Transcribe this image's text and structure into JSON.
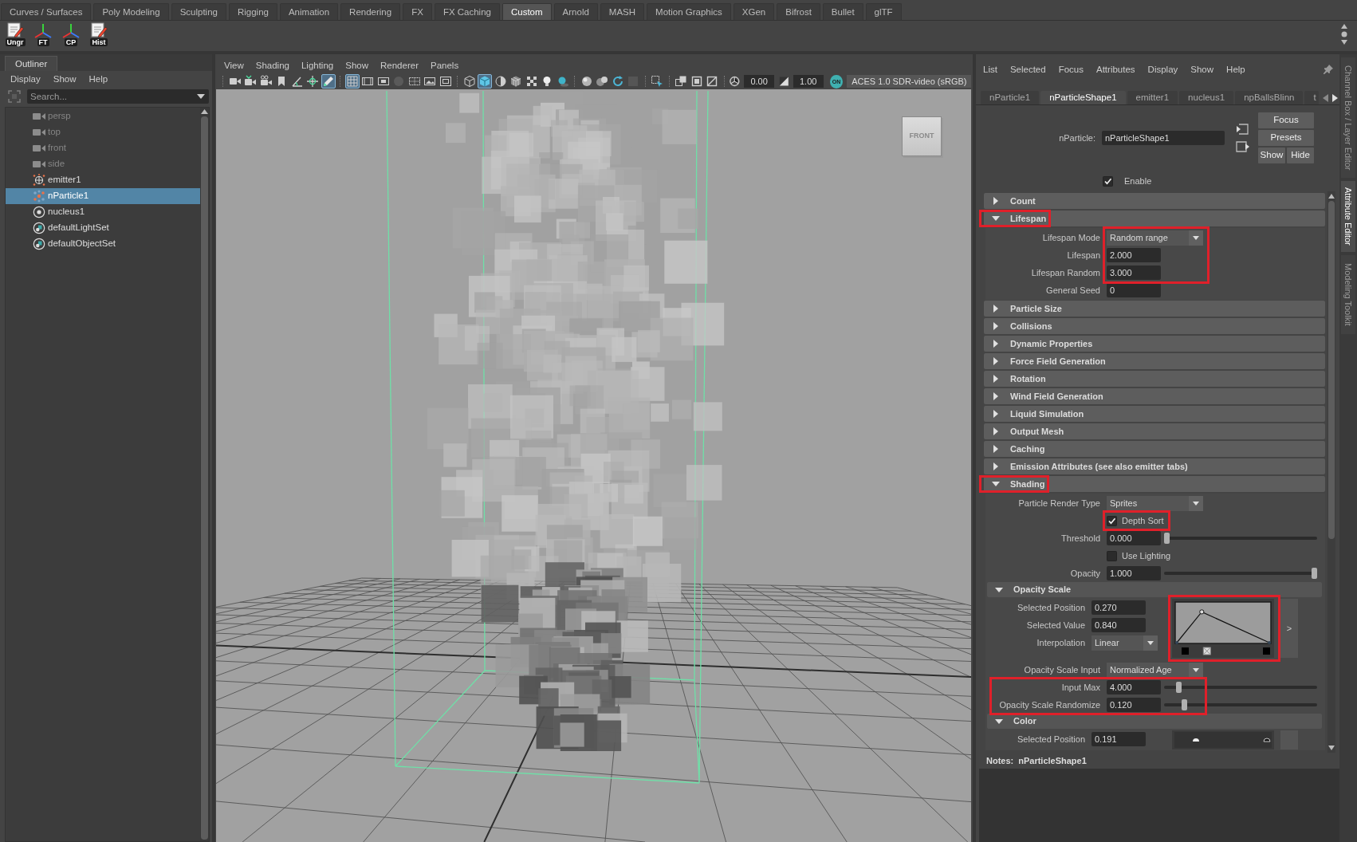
{
  "shelf": {
    "tabs": [
      {
        "label": "Curves / Surfaces",
        "selected": false
      },
      {
        "label": "Poly Modeling",
        "selected": false
      },
      {
        "label": "Sculpting",
        "selected": false
      },
      {
        "label": "Rigging",
        "selected": false
      },
      {
        "label": "Animation",
        "selected": false
      },
      {
        "label": "Rendering",
        "selected": false
      },
      {
        "label": "FX",
        "selected": false
      },
      {
        "label": "FX Caching",
        "selected": false
      },
      {
        "label": "Custom",
        "selected": true
      },
      {
        "label": "Arnold",
        "selected": false
      },
      {
        "label": "MASH",
        "selected": false
      },
      {
        "label": "Motion Graphics",
        "selected": false
      },
      {
        "label": "XGen",
        "selected": false
      },
      {
        "label": "Bifrost",
        "selected": false
      },
      {
        "label": "Bullet",
        "selected": false
      },
      {
        "label": "glTF",
        "selected": false
      }
    ],
    "buttons": [
      {
        "label": "Ungr"
      },
      {
        "label": "FT"
      },
      {
        "label": "CP"
      },
      {
        "label": "Hist"
      }
    ]
  },
  "outliner": {
    "title": "Outliner",
    "menu": [
      "Display",
      "Show",
      "Help"
    ],
    "search": {
      "placeholder": "Search..."
    },
    "items": [
      {
        "label": "persp",
        "kind": "camera",
        "dimmed": true,
        "selected": false
      },
      {
        "label": "top",
        "kind": "camera",
        "dimmed": true,
        "selected": false
      },
      {
        "label": "front",
        "kind": "camera",
        "dimmed": true,
        "selected": false
      },
      {
        "label": "side",
        "kind": "camera",
        "dimmed": true,
        "selected": false
      },
      {
        "label": "emitter1",
        "kind": "emitter",
        "dimmed": false,
        "selected": false
      },
      {
        "label": "nParticle1",
        "kind": "particles",
        "dimmed": false,
        "selected": true
      },
      {
        "label": "nucleus1",
        "kind": "nucleus",
        "dimmed": false,
        "selected": false
      },
      {
        "label": "defaultLightSet",
        "kind": "set",
        "dimmed": false,
        "selected": false
      },
      {
        "label": "defaultObjectSet",
        "kind": "set",
        "dimmed": false,
        "selected": false
      }
    ]
  },
  "viewport": {
    "menu": [
      "View",
      "Shading",
      "Lighting",
      "Show",
      "Renderer",
      "Panels"
    ],
    "toolbar": {
      "buttons": [
        {
          "on": false
        },
        {
          "on": false
        },
        {
          "on": false
        },
        {
          "on": false
        },
        {
          "on": false
        },
        {
          "on": false
        },
        {
          "on": true
        },
        {
          "on": true
        },
        {
          "on": false
        },
        {
          "on": false
        },
        {
          "on": false
        },
        {
          "on": false
        },
        {
          "on": false
        },
        {
          "on": false
        },
        {
          "on": false
        },
        {
          "on": true
        },
        {
          "on": false
        },
        {
          "on": false
        },
        {
          "on": false
        },
        {
          "on": false
        },
        {
          "on": false
        },
        {
          "on": false
        },
        {
          "on": false
        },
        {
          "on": false
        },
        {
          "on": false
        },
        {
          "on": false
        },
        {
          "on": false
        },
        {
          "on": false
        },
        {
          "on": false
        }
      ],
      "exposure": "0.00",
      "gamma": "1.00",
      "color_management": {
        "label": "ON",
        "on": true
      },
      "color_space": "ACES 1.0 SDR-video (sRGB)"
    },
    "view_cube": "FRONT"
  },
  "attribute_editor": {
    "menu": [
      "List",
      "Selected",
      "Focus",
      "Attributes",
      "Display",
      "Show",
      "Help"
    ],
    "tabs": [
      {
        "label": "nParticle1",
        "selected": false
      },
      {
        "label": "nParticleShape1",
        "selected": true
      },
      {
        "label": "emitter1",
        "selected": false
      },
      {
        "label": "nucleus1",
        "selected": false
      },
      {
        "label": "npBallsBlinn",
        "selected": false
      },
      {
        "label": "t",
        "selected": false
      }
    ],
    "node": {
      "label": "nParticle:",
      "value": "nParticleShape1"
    },
    "buttons": [
      "Focus",
      "Presets",
      "Show",
      "Hide"
    ],
    "enable": {
      "label": "Enable",
      "checked": true
    },
    "sections": [
      {
        "title": "Count",
        "expanded": false,
        "highlighted": false
      },
      {
        "title": "Lifespan",
        "expanded": true,
        "highlighted": true,
        "rows": [
          {
            "kind": "dropdown",
            "label": "Lifespan Mode",
            "value": "Random range",
            "highlighted": true
          },
          {
            "kind": "number",
            "label": "Lifespan",
            "value": "2.000",
            "highlighted": true
          },
          {
            "kind": "number",
            "label": "Lifespan Random",
            "value": "3.000",
            "highlighted": true
          },
          {
            "kind": "number",
            "label": "General Seed",
            "value": "0",
            "highlighted": false
          }
        ]
      },
      {
        "title": "Particle Size",
        "expanded": false,
        "highlighted": false
      },
      {
        "title": "Collisions",
        "expanded": false,
        "highlighted": false
      },
      {
        "title": "Dynamic Properties",
        "expanded": false,
        "highlighted": false
      },
      {
        "title": "Force Field Generation",
        "expanded": false,
        "highlighted": false
      },
      {
        "title": "Rotation",
        "expanded": false,
        "highlighted": false
      },
      {
        "title": "Wind Field Generation",
        "expanded": false,
        "highlighted": false
      },
      {
        "title": "Liquid Simulation",
        "expanded": false,
        "highlighted": false
      },
      {
        "title": "Output Mesh",
        "expanded": false,
        "highlighted": false
      },
      {
        "title": "Caching",
        "expanded": false,
        "highlighted": false
      },
      {
        "title": "Emission Attributes (see also emitter tabs)",
        "expanded": false,
        "highlighted": false
      },
      {
        "title": "Shading",
        "expanded": true,
        "highlighted": true,
        "rows": [
          {
            "kind": "dropdown",
            "label": "Particle Render Type",
            "value": "Sprites",
            "highlighted": false
          },
          {
            "kind": "checkbox",
            "label": "Depth Sort",
            "checked": true,
            "highlighted": true
          },
          {
            "kind": "slider",
            "label": "Threshold",
            "value": "0.000",
            "level": 0,
            "highlighted": false
          },
          {
            "kind": "checkbox",
            "label": "Use Lighting",
            "checked": false,
            "highlighted": false
          },
          {
            "kind": "slider",
            "label": "Opacity",
            "value": "1.000",
            "level": 1,
            "highlighted": false
          },
          {
            "kind": "subsection",
            "title": "Opacity Scale",
            "expanded": true,
            "highlighted": false,
            "rows": [
              {
                "kind": "curve_ramp",
                "fields": [
                  {
                    "label": "Selected Position",
                    "value": "0.270"
                  },
                  {
                    "label": "Selected Value",
                    "value": "0.840"
                  }
                ],
                "interpolation": {
                  "label": "Interpolation",
                  "value": "Linear"
                },
                "button": ">",
                "highlighted": true
              },
              {
                "kind": "dropdown",
                "label": "Opacity Scale Input",
                "value": "Normalized Age",
                "highlighted": false
              },
              {
                "kind": "slider",
                "label": "Input Max",
                "value": "4.000",
                "level": 0.08,
                "highlighted": true
              },
              {
                "kind": "slider",
                "label": "Opacity Scale Randomize",
                "value": "0.120",
                "level": 0.12,
                "highlighted": true
              }
            ]
          },
          {
            "kind": "subsection",
            "title": "Color",
            "expanded": true,
            "highlighted": false,
            "rows": [
              {
                "kind": "color_ramp",
                "fields": [
                  {
                    "label": "Selected Position",
                    "value": "0.191"
                  }
                ],
                "highlighted": false
              }
            ]
          }
        ]
      }
    ],
    "notes": {
      "label": "Notes:",
      "node": "nParticleShape1"
    }
  },
  "side_tabs": [
    {
      "label": "Channel Box / Layer Editor",
      "selected": false
    },
    {
      "label": "Attribute Editor",
      "selected": true
    },
    {
      "label": "Modeling Toolkit",
      "selected": false
    }
  ]
}
